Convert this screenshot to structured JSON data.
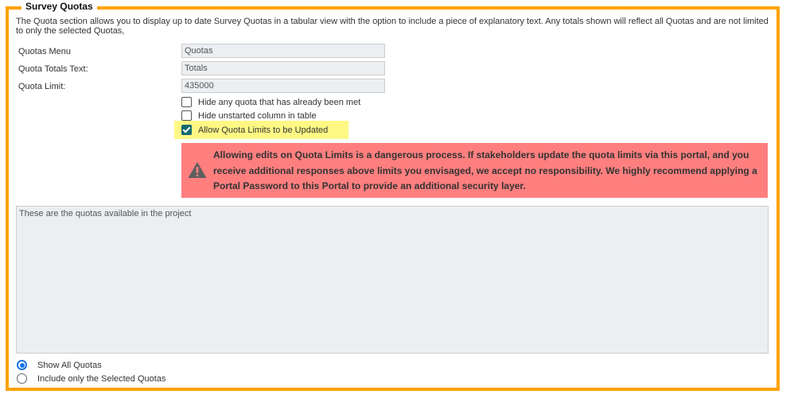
{
  "section": {
    "title": "Survey Quotas",
    "description": "The Quota section allows you to display up to date Survey Quotas in a tabular view with the option to include a piece of explanatory text. Any totals shown will reflect all Quotas and are not limited to only the selected Quotas,"
  },
  "fields": [
    {
      "label": "Quotas Menu",
      "value": "Quotas"
    },
    {
      "label": "Quota Totals Text:",
      "value": "Totals"
    },
    {
      "label": "Quota Limit:",
      "value": "435000"
    }
  ],
  "checkboxes": [
    {
      "label": "Hide any quota that has already been met",
      "checked": false
    },
    {
      "label": "Hide unstarted column in table",
      "checked": false
    },
    {
      "label": "Allow Quota Limits to be Updated",
      "checked": true,
      "highlighted": true
    }
  ],
  "warning": {
    "icon": "warning-triangle-icon",
    "text": "Allowing edits on Quota Limits is a dangerous process. If stakeholders update the quota limits via this portal, and you receive additional responses above limits you envisaged, we accept no responsibility. We highly recommend applying a Portal Password to this Portal to provide an additional security layer.",
    "color": "#ff7f7f"
  },
  "explanatory_text": "These are the quotas available in the project",
  "radios": [
    {
      "label": "Show All Quotas",
      "checked": true
    },
    {
      "label": "Include only the Selected Quotas",
      "checked": false
    }
  ],
  "colors": {
    "border_accent": "#ffa200",
    "highlight": "#fff884",
    "checkbox_checked": "#146a70",
    "radio_checked": "#1a73e8"
  }
}
